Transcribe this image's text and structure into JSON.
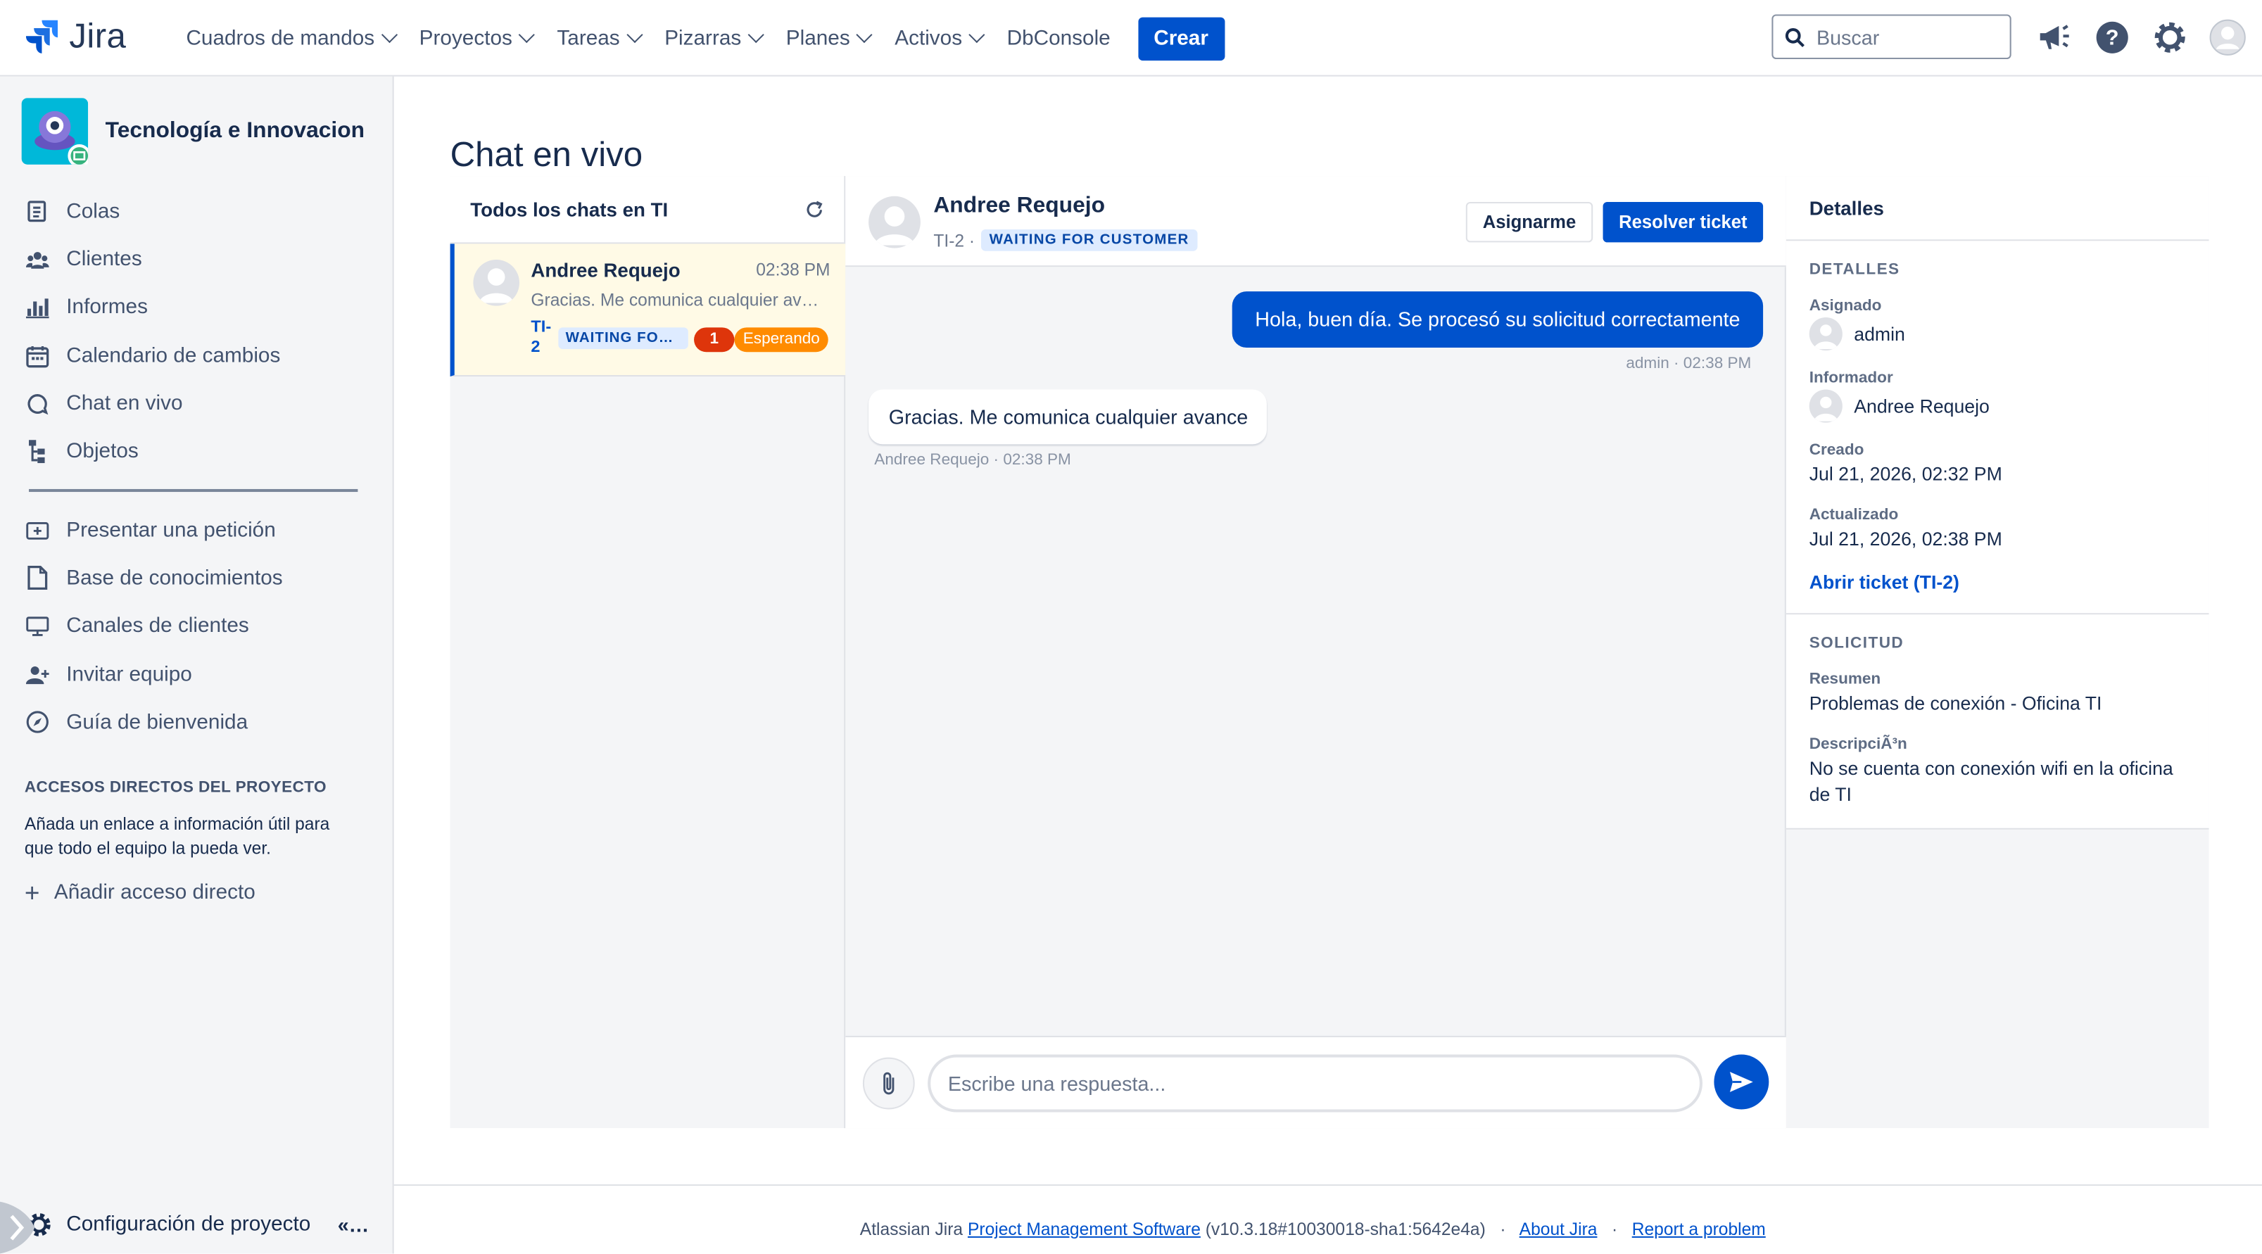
{
  "app": {
    "logo_text": "Jira"
  },
  "topnav": {
    "items": [
      "Cuadros de mandos",
      "Proyectos",
      "Tareas",
      "Pizarras",
      "Planes",
      "Activos",
      "DbConsole"
    ],
    "create_label": "Crear",
    "search_placeholder": "Buscar"
  },
  "sidebar": {
    "project_name": "Tecnología e Innovacion",
    "items": [
      "Colas",
      "Clientes",
      "Informes",
      "Calendario de cambios",
      "Chat en vivo",
      "Objetos"
    ],
    "items2": [
      "Presentar una petición",
      "Base de conocimientos",
      "Canales de clientes",
      "Invitar equipo",
      "Guía de bienvenida"
    ],
    "shortcuts_title": "ACCESOS DIRECTOS DEL PROYECTO",
    "shortcuts_desc": "Añada un enlace a información útil para que todo el equipo la pueda ver.",
    "add_shortcut": "Añadir acceso directo",
    "config": "Configuración de proyecto"
  },
  "page": {
    "title": "Chat en vivo"
  },
  "chatlist": {
    "header": "Todos los chats en TI",
    "card": {
      "name": "Andree Requejo",
      "time": "02:38 PM",
      "message": "Gracias. Me comunica cualquier avance",
      "key": "TI-2",
      "status": "WAITING FOR CUSTOMER",
      "count": "1",
      "waiting": "Esperando"
    }
  },
  "conversation": {
    "name": "Andree Requejo",
    "key": "TI-2 ·",
    "status": "WAITING FOR CUSTOMER",
    "assign_label": "Asignarme",
    "resolve_label": "Resolver ticket",
    "messages": [
      {
        "text": "Hola, buen día. Se procesó su solicitud correctamente",
        "meta": "admin · 02:38 PM"
      },
      {
        "text": "Gracias. Me comunica cualquier avance",
        "meta": "Andree Requejo · 02:38 PM"
      }
    ],
    "reply_placeholder": "Escribe una respuesta..."
  },
  "details": {
    "header": "Detalles",
    "section1_title": "DETALLES",
    "assigned_label": "Asignado",
    "assigned_value": "admin",
    "reporter_label": "Informador",
    "reporter_value": "Andree Requejo",
    "created_label": "Creado",
    "created_value": "Jul 21, 2026, 02:32 PM",
    "updated_label": "Actualizado",
    "updated_value": "Jul 21, 2026, 02:38 PM",
    "open_ticket": "Abrir ticket (TI-2)",
    "section2_title": "SOLICITUD",
    "summary_label": "Resumen",
    "summary_value": "Problemas de conexión - Oficina TI",
    "description_label": "DescripciÃ³n",
    "description_value": "No se cuenta con conexión wifi en la oficina de TI"
  },
  "footer": {
    "prefix": "Atlassian Jira",
    "link1": "Project Management Software",
    "version": "(v10.3.18#10030018-sha1:5642e4a)",
    "sep": "·",
    "link2": "About Jira",
    "link3": "Report a problem"
  },
  "colors": {
    "accent": "#0052cc",
    "sidebar_bg": "#f4f5f7",
    "selected_card": "#fffae6",
    "warning": "#ff8b00",
    "danger": "#de350b"
  }
}
